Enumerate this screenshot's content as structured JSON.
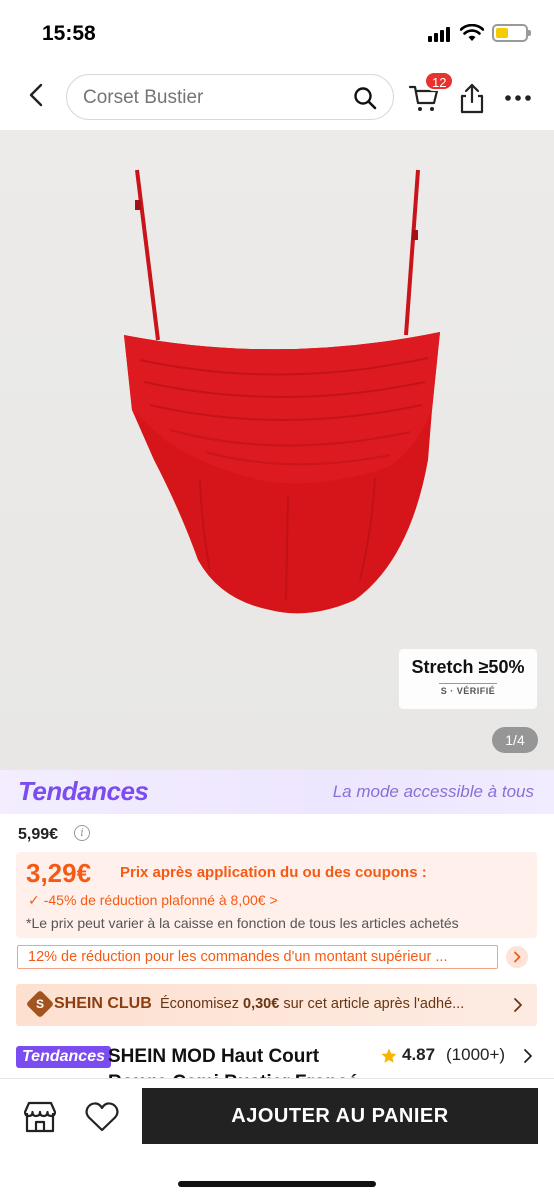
{
  "status": {
    "time": "15:58"
  },
  "header": {
    "search_value": "Corset Bustier",
    "cart_count": "12"
  },
  "gallery": {
    "stretch_title": "Stretch ≥50%",
    "stretch_sub": "S · VÉRIFIÉ",
    "page_indicator": "1/4",
    "product_color": "#d6151b"
  },
  "trends": {
    "logo": "Tendances",
    "tagline": "La mode accessible à tous"
  },
  "pricing": {
    "original_price": "5,99€",
    "coupon_price": "3,29€",
    "coupon_label": "Prix après application du ou des coupons :",
    "discount_text": "-45% de réduction plafonné à 8,00€ >",
    "note": "*Le prix peut varier à la caisse en fonction de tous les articles achetés",
    "promo": "12% de réduction pour les commandes d'un montant supérieur ...",
    "accent_color": "#f55a14"
  },
  "club": {
    "name": "SHEIN CLUB",
    "text_before": "Économisez ",
    "amount": "0,30€",
    "text_after": " sur cet article après l'adhé..."
  },
  "product": {
    "tag": "Tendances",
    "title": "SHEIN MOD Haut Court Rouge Cami Bustier Froncé Uni",
    "rating": "4.87",
    "rating_count": "(1000+)"
  },
  "actions": {
    "add_to_cart": "AJOUTER AU PANIER"
  }
}
